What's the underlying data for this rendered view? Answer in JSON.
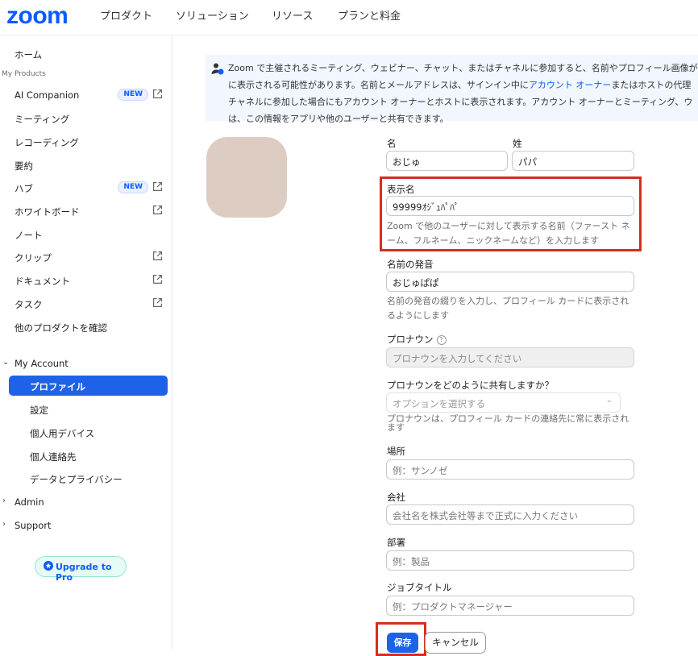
{
  "brand": {
    "logo_text": "zoom",
    "color": "#0b5cff"
  },
  "topnav": {
    "items": [
      "プロダクト",
      "ソリューション",
      "リソース",
      "プランと料金"
    ]
  },
  "sidebar": {
    "home": "ホーム",
    "products_section": "My Products",
    "items": [
      {
        "label": "AI Companion",
        "badge": "NEW",
        "icon": "external-link-icon"
      },
      {
        "label": "ミーティング"
      },
      {
        "label": "レコーディング"
      },
      {
        "label": "要約"
      },
      {
        "label": "ハブ",
        "badge": "NEW",
        "icon": "external-link-icon"
      },
      {
        "label": "ホワイトボード",
        "icon": "external-link-icon"
      },
      {
        "label": "ノート"
      },
      {
        "label": "クリップ",
        "icon": "external-link-icon"
      },
      {
        "label": "ドキュメント",
        "icon": "external-link-icon"
      },
      {
        "label": "タスク",
        "icon": "external-link-icon"
      },
      {
        "label": "他のプロダクトを確認"
      }
    ],
    "account": {
      "label": "My Account",
      "children": [
        "プロファイル",
        "設定",
        "個人用デバイス",
        "個人連絡先",
        "データとプライバシー"
      ],
      "active": "プロファイル"
    },
    "admin": "Admin",
    "support": "Support",
    "upgrade": "Upgrade to Pro",
    "active_color": "#1e62e8"
  },
  "notice": {
    "line1": "Zoom で主催されるミーティング、ウェビナー、チャット、またはチャネルに参加すると、名前やプロフィール画像が",
    "line2_a": "に表示される可能性があります。名前とメールアドレスは、サインイン中に",
    "line2_link": "アカウント オーナー",
    "line2_b": "またはホストの代理",
    "line3": "チャネルに参加した場合にもアカウント オーナーとホストに表示されます。アカウント オーナーとミーティング、ウ",
    "line4": "は、この情報をアプリや他のユーザーと共有できます。"
  },
  "form": {
    "first_name": {
      "label": "名",
      "value": "おじゅ"
    },
    "last_name": {
      "label": "姓",
      "value": "パパ"
    },
    "display_name": {
      "label": "表示名",
      "value": "99999ｵｼﾞｭﾊﾟﾊﾟ",
      "helper1": "Zoom で他のユーザーに対して表示する名前（ファースト ネ",
      "helper2": "ーム、フルネーム、ニックネームなど）を入力します"
    },
    "pronunciation": {
      "label": "名前の発音",
      "value": "おじゅぱぱ",
      "helper1": "名前の発音の綴りを入力し、プロフィール カードに表示され",
      "helper2": "るようにします"
    },
    "pronoun": {
      "label": "プロナウン",
      "placeholder": "プロナウンを入力してください"
    },
    "pronoun_share": {
      "label": "プロナウンをどのように共有しますか？",
      "placeholder": "オプションを選択する",
      "helper1": "プロナウンは、プロフィール カードの連絡先に常に表示され",
      "helper2": "ます"
    },
    "location": {
      "label": "場所",
      "placeholder": "例：サンノゼ"
    },
    "company": {
      "label": "会社",
      "placeholder": "会社名を株式会社等まで正式に入力ください"
    },
    "department": {
      "label": "部署",
      "placeholder": "例：製品"
    },
    "job_title": {
      "label": "ジョブタイトル",
      "placeholder": "例：プロダクトマネージャー"
    },
    "save": "保存",
    "cancel": "キャンセル"
  },
  "highlight_color": "#d42e20"
}
